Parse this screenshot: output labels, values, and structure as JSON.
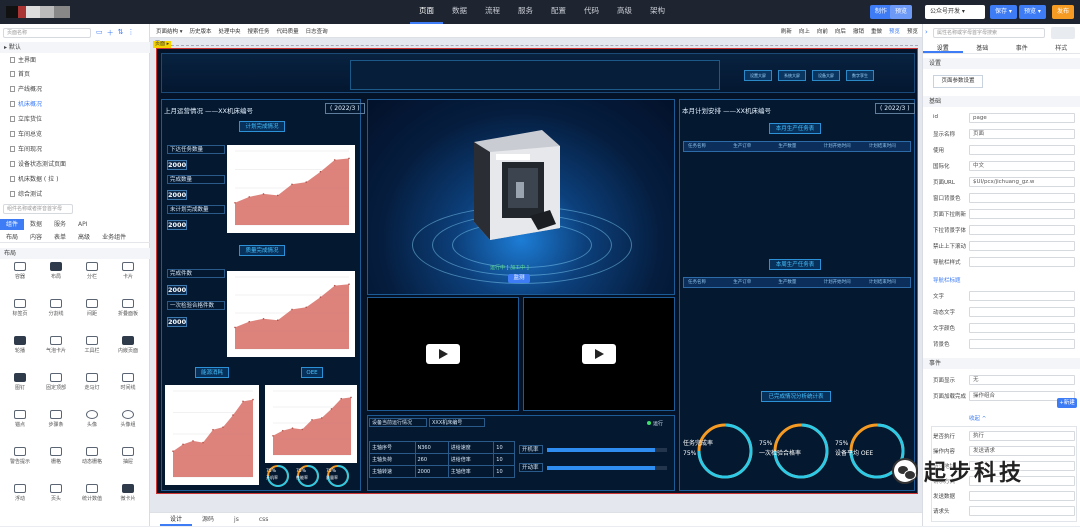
{
  "topbar": {
    "menu": [
      "页面",
      "数据",
      "流程",
      "服务",
      "配置",
      "代码",
      "高级",
      "架构"
    ],
    "active_menu": "页面",
    "mode_make": "制作",
    "mode_preview": "预览",
    "env": "公众号开发 ▾",
    "save": "保存 ▾",
    "preview": "预览 ▾",
    "publish": "发布"
  },
  "left": {
    "search_placeholder": "页面名称",
    "section_default": "▸ 默认",
    "pages": [
      "主界面",
      "首页",
      "产线概况",
      "机床概况",
      "立库货位",
      "车间总览",
      "车间现况",
      "设备状态测试页面",
      "机床数据 ( 拉 )",
      "综合测试"
    ],
    "selected_page": "机床概况",
    "comp_search_placeholder": "组件名称或者拼音首字母",
    "tabs": [
      "组件",
      "数据",
      "服务",
      "API"
    ],
    "sub_tabs": [
      "布局",
      "内容",
      "表单",
      "高级",
      "业务组件"
    ],
    "section_layout": "布局",
    "components": [
      "容器",
      "布局",
      "分栏",
      "卡片",
      "标签页",
      "分割线",
      "间距",
      "折叠面板",
      "轮播",
      "气泡卡片",
      "工具栏",
      "内嵌页面",
      "图钉",
      "固定顶部",
      "走马灯",
      "时间线",
      "锚点",
      "步骤条",
      "头像",
      "头像组",
      "警告提示",
      "栅格",
      "动态栅格",
      "抽屉",
      "浮动",
      "页头",
      "统计数值",
      "微卡片"
    ]
  },
  "canvas": {
    "toolbar_left": [
      "页面结构 ▾",
      "历史版本",
      "处理中央",
      "搜索任务",
      "代码质量",
      "日志查询"
    ],
    "toolbar_right": [
      "刷新",
      "向上",
      "向前",
      "向后",
      "撤销",
      "重做",
      "预览",
      "预览"
    ],
    "page_tag": "页面 ▸",
    "bottom_tabs": [
      "设计",
      "源码",
      "js",
      "css"
    ]
  },
  "dash": {
    "header_buttons": [
      "设置大屏",
      "系统大屏",
      "设备大屏",
      "数字孪生"
    ],
    "left_title": "上月运营情况 ——XX机床编号",
    "left_date": "( 2022/3 )",
    "plan_title": "计划完成情况",
    "plan_rows": [
      {
        "label": "下达任务数量",
        "value": "2000"
      },
      {
        "label": "完成数量",
        "value": "2000"
      },
      {
        "label": "未计划完成数量",
        "value": "2000"
      }
    ],
    "quality_title": "质量完成情况",
    "quality_rows": [
      {
        "label": "完成件数",
        "value": "2000"
      },
      {
        "label": "一次检验合格件数",
        "value": "2000"
      }
    ],
    "energy_title": "能源消耗",
    "oee_title": "OEE",
    "oee_mini": [
      "75%",
      "75%",
      "75%"
    ],
    "oee_mini_labels": [
      "开机率",
      "性能率",
      "质量率"
    ],
    "machine_status": "运行中 [ 加工中 ]",
    "machine_button": "监测",
    "right_title": "本月计划安排 ——XX机床编号",
    "right_date": "( 2022/3 )",
    "monthly_plan_title": "本月生产任务表",
    "plan_headers": [
      "任务名称",
      "生产订单",
      "生产数量",
      "计划开始时间",
      "计划结束时间"
    ],
    "production_title": "本周生产任务表",
    "prod_headers": [
      "任务名称",
      "生产订单",
      "生产数量",
      "计划开始时间",
      "计划结束时间"
    ],
    "completion_title": "已完成情况分析统计表",
    "gauges": [
      {
        "value": "75%",
        "label": "任务完成率"
      },
      {
        "value": "75%",
        "label": "一次检验合格率"
      },
      {
        "value": "75%",
        "label": "设备平均 OEE"
      }
    ],
    "device_title": "设备当前运行情况",
    "device_id": "XXX机床编号",
    "running": "运行",
    "device_table": [
      [
        "主轴序号",
        "N360",
        "进给速度",
        "10"
      ],
      [
        "主轴负荷",
        "260",
        "进给倍率",
        "10"
      ],
      [
        "主轴转速",
        "2000",
        "主轴倍率",
        "10"
      ]
    ],
    "bars": [
      {
        "label": "开机率",
        "fraction": 0.9
      },
      {
        "label": "开动率",
        "fraction": 0.9
      }
    ]
  },
  "area_chart": {
    "type": "area",
    "values": [
      30,
      38,
      42,
      40,
      55,
      58,
      72,
      88,
      90
    ],
    "ylim": [
      0,
      100
    ],
    "color": "#d9756e"
  },
  "right": {
    "search_placeholder": "属性名称或字母首字母搜索",
    "tabs": [
      "设置",
      "基础",
      "事件",
      "样式"
    ],
    "section_settings": "设置",
    "page_param_btn": "页面参数设置",
    "section_basic": "基础",
    "rows": [
      {
        "k": "id",
        "v": "page"
      },
      {
        "k": "显示名称",
        "v": "页面"
      },
      {
        "k": "使用",
        "v": ""
      },
      {
        "k": "国际化",
        "v": "中文"
      },
      {
        "k": "页面URL",
        "v": "$UI/pcx/jichuang_gz.w"
      },
      {
        "k": "窗口背景色",
        "v": ""
      },
      {
        "k": "页面下拉刷新",
        "v": ""
      },
      {
        "k": "下拉背景字体",
        "v": ""
      },
      {
        "k": "禁止上下滚动",
        "v": ""
      },
      {
        "k": "导航栏样式",
        "v": ""
      }
    ],
    "nav_title": "导航栏标题",
    "nav_rows": [
      {
        "k": "文字",
        "v": ""
      },
      {
        "k": "动态文字",
        "v": ""
      },
      {
        "k": "文字颜色",
        "v": ""
      },
      {
        "k": "背景色",
        "v": ""
      }
    ],
    "section_events": "事件",
    "events": [
      {
        "k": "页面显示",
        "v": "无"
      },
      {
        "k": "页面加载完成",
        "v": "操作组合"
      }
    ],
    "new_btn": "+新建",
    "collapse": "收起 ^",
    "exec_rows": [
      {
        "k": "是否执行",
        "v": "执行"
      },
      {
        "k": "操作内容",
        "v": "发送请求"
      },
      {
        "k": "请求地址",
        "v": ""
      },
      {
        "k": "请求方式",
        "v": ""
      },
      {
        "k": "发送数据",
        "v": ""
      },
      {
        "k": "请求头",
        "v": ""
      }
    ]
  },
  "watermark": "起步科技",
  "colors": {
    "accent": "#3d7cf5",
    "dash_bg": "#041327",
    "cyan": "#2ec9e6",
    "orange": "#f59a23"
  }
}
